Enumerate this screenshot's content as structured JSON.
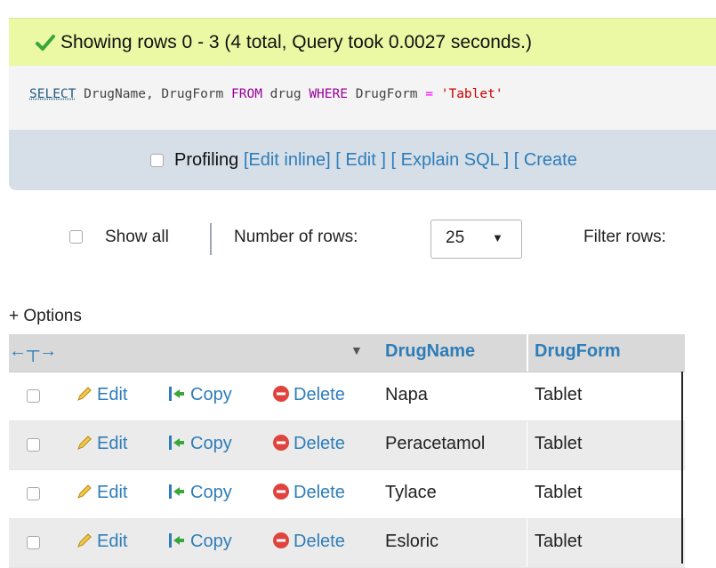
{
  "status": {
    "message": "Showing rows 0 - 3 (4 total, Query took 0.0027 seconds.)",
    "color": "#ebf8a4"
  },
  "sql": {
    "select": "SELECT",
    "cols": " DrugName, DrugForm ",
    "from": "FROM",
    "table": " drug ",
    "where": "WHERE",
    "col": " DrugForm ",
    "op": "=",
    "value": " 'Tablet'"
  },
  "toolbar": {
    "profiling": "Profiling",
    "links": [
      "[Edit inline]",
      "[ Edit ]",
      "[ Explain SQL ]",
      "[ Create"
    ]
  },
  "nav": {
    "show_all": "Show all",
    "number_of_rows_label": "Number of rows:",
    "rows_value": "25",
    "filter_label": "Filter rows:"
  },
  "options_label": "+ Options",
  "table": {
    "headers": [
      "DrugName",
      "DrugForm"
    ],
    "actions": {
      "edit": "Edit",
      "copy": "Copy",
      "delete": "Delete"
    },
    "rows": [
      {
        "name": "Napa",
        "form": "Tablet"
      },
      {
        "name": "Peracetamol",
        "form": "Tablet"
      },
      {
        "name": "Tylace",
        "form": "Tablet"
      },
      {
        "name": "Esloric",
        "form": "Tablet"
      }
    ]
  }
}
